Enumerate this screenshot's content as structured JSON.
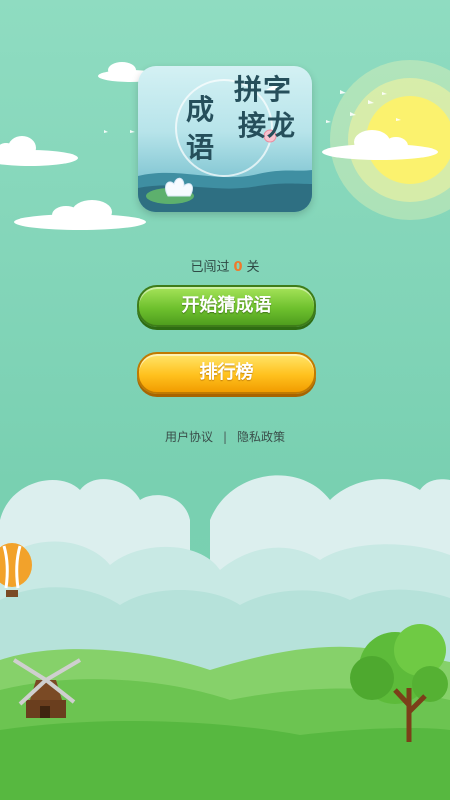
{
  "logo": {
    "title_left_1": "成",
    "title_left_2": "语",
    "title_right_1": "拼字",
    "title_right_2": "接龙"
  },
  "progress": {
    "prefix": "已闯过",
    "count": "0",
    "suffix": "关"
  },
  "buttons": {
    "start_label": "开始猜成语",
    "rank_label": "排行榜"
  },
  "footer": {
    "user_agreement": "用户协议",
    "separator": "|",
    "privacy_policy": "隐私政策"
  },
  "colors": {
    "sky": "#8fdcc1",
    "start_button": "#6fc12e",
    "rank_button": "#ffc11e",
    "level_count": "#f07a2b"
  }
}
